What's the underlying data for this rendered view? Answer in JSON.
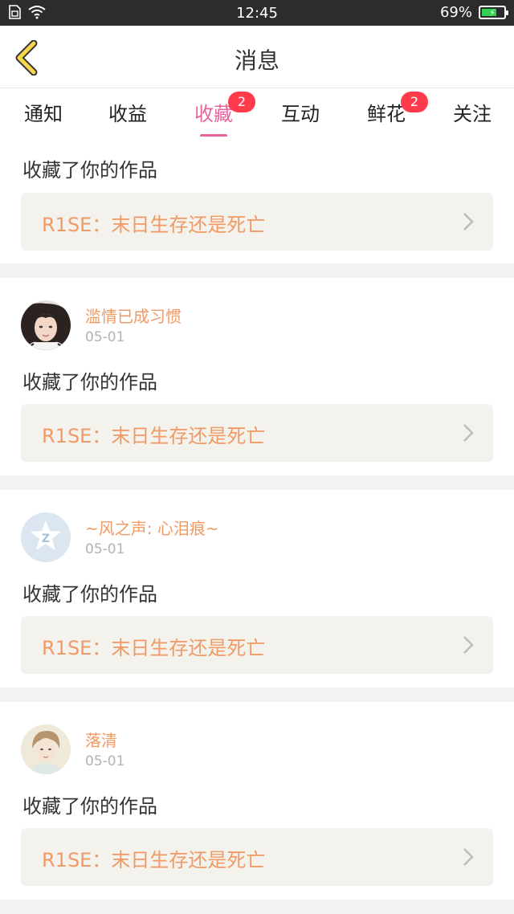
{
  "status_bar": {
    "time": "12:45",
    "battery": "69%",
    "battery_level": 0.69
  },
  "header": {
    "title": "消息",
    "back_icon": "chevron-left-icon"
  },
  "tabs": [
    {
      "label": "通知",
      "badge": ""
    },
    {
      "label": "收益",
      "badge": ""
    },
    {
      "label": "收藏",
      "badge": "2",
      "active": true
    },
    {
      "label": "互动",
      "badge": ""
    },
    {
      "label": "鲜花",
      "badge": "2"
    },
    {
      "label": "关注",
      "badge": ""
    }
  ],
  "colors": {
    "accent": "#e9649c",
    "orange": "#f09a66",
    "badge": "#ff3b4c"
  },
  "items": [
    {
      "user": "",
      "date": "",
      "action": "收藏了你的作品",
      "work": "R1SE：末日生存还是死亡"
    },
    {
      "user": "滥情已成习惯",
      "date": "05-01",
      "action": "收藏了你的作品",
      "work": "R1SE：末日生存还是死亡"
    },
    {
      "user": "~风之声: 心泪痕~",
      "date": "05-01",
      "action": "收藏了你的作品",
      "work": "R1SE：末日生存还是死亡"
    },
    {
      "user": "落清",
      "date": "05-01",
      "action": "收藏了你的作品",
      "work": "R1SE：末日生存还是死亡"
    }
  ]
}
